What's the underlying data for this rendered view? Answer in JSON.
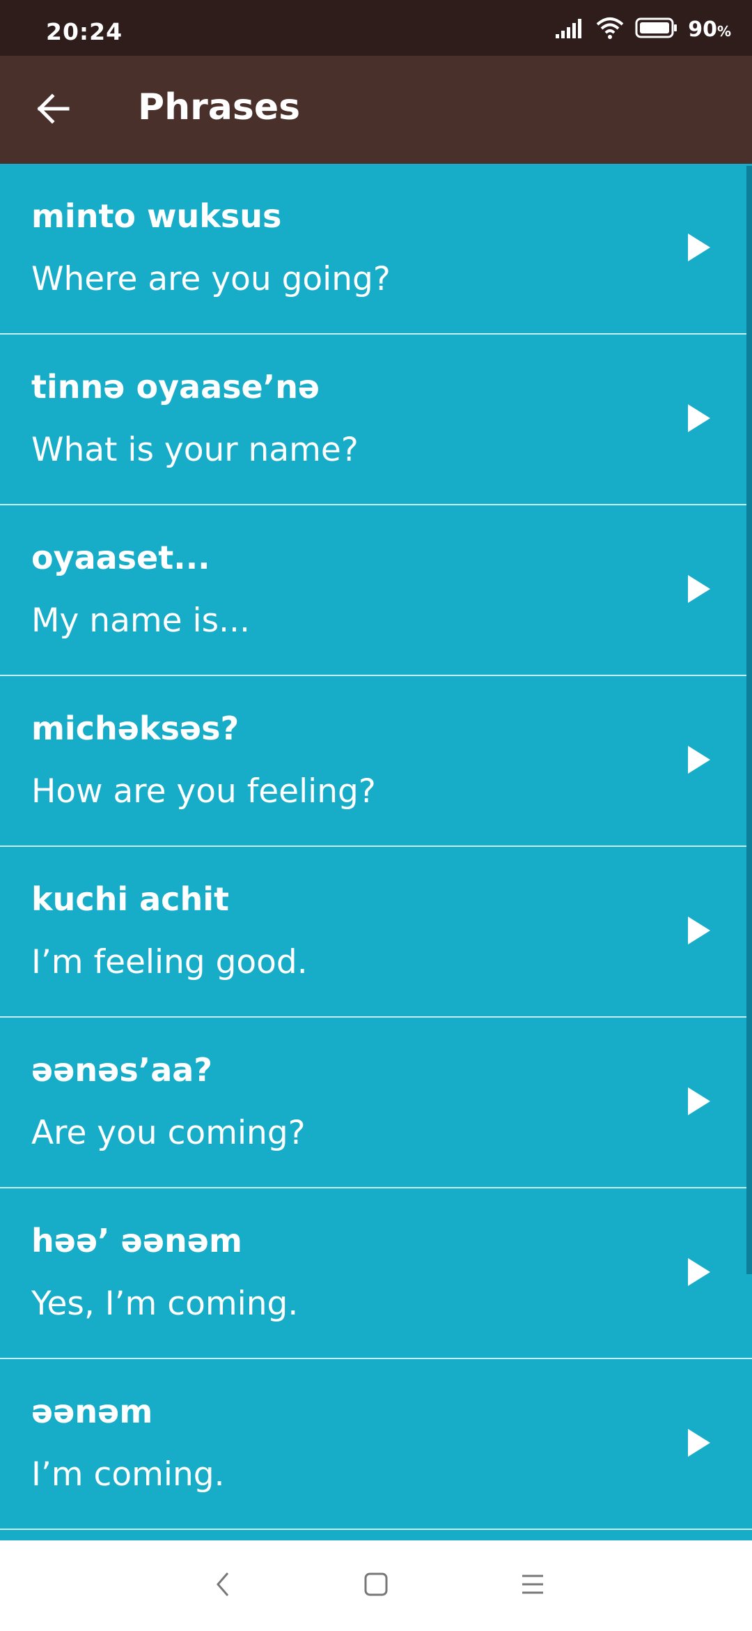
{
  "status_bar": {
    "time": "20:24",
    "battery": "90",
    "battery_unit": "%"
  },
  "app_bar": {
    "title": "Phrases"
  },
  "phrases": [
    {
      "native": "minto wuksus",
      "english": "Where are you going?"
    },
    {
      "native": "tinnə oyaase’nə",
      "english": "What is your name?"
    },
    {
      "native": "oyaaset...",
      "english": "My name is..."
    },
    {
      "native": "michəksəs?",
      "english": "How are you feeling?"
    },
    {
      "native": "kuchi achit",
      "english": "I’m feeling good."
    },
    {
      "native": "əənəs’aa?",
      "english": "Are you coming?"
    },
    {
      "native": "həə’ əənəm",
      "english": "Yes, I’m coming."
    },
    {
      "native": "əənəm",
      "english": "I’m coming."
    }
  ],
  "colors": {
    "status_bar": "#2f1d1c",
    "app_bar": "#4a302a",
    "list_background": "#17adc9",
    "divider": "#c7eef5"
  },
  "icons": {
    "back": "arrow-left-icon",
    "play": "play-icon",
    "nav_back": "chevron-left-icon",
    "nav_home": "square-icon",
    "nav_menu": "menu-icon"
  }
}
